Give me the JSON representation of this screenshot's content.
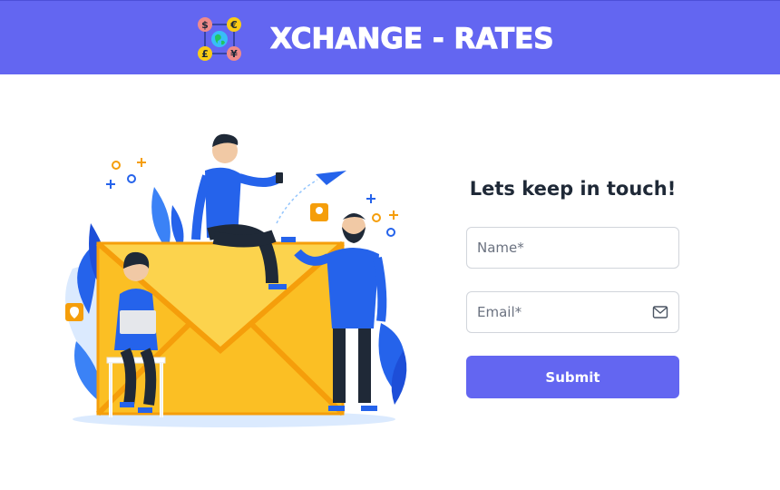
{
  "header": {
    "brand_title": "XCHANGE - RATES",
    "background_color": "#6366f1",
    "logo_icon": "currency-exchange-globe-icon",
    "logo_symbols": [
      "$",
      "€",
      "£",
      "¥"
    ]
  },
  "illustration": {
    "icon": "contact-envelope-people-illustration"
  },
  "contact_form": {
    "title": "Lets keep in touch!",
    "name_placeholder": "Name*",
    "email_placeholder": "Email*",
    "email_icon": "mail-icon",
    "submit_label": "Submit",
    "accent_color": "#6366f1"
  }
}
